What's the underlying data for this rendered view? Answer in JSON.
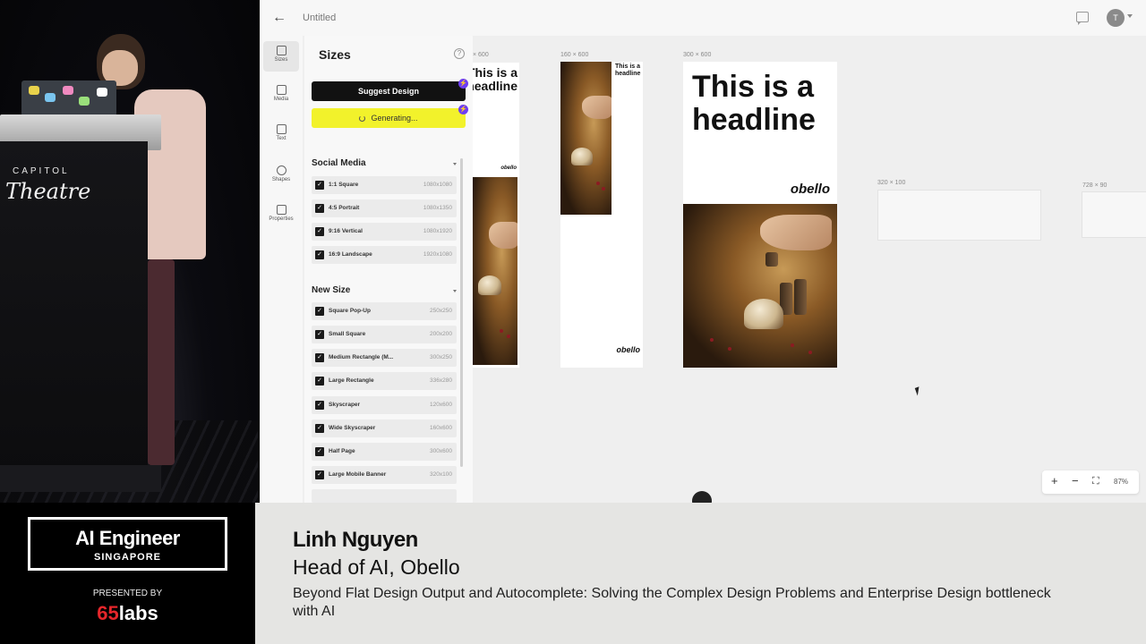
{
  "stage": {
    "venue_top": "CAPITOL",
    "venue_name": "Theatre"
  },
  "app": {
    "document_title": "Untitled",
    "user_initial": "T",
    "icons": {
      "back": "arrow-left-icon",
      "comment": "comment-icon",
      "help": "question-circle-icon",
      "lightning": "lightning-icon"
    },
    "rail": [
      {
        "label": "Sizes",
        "icon": "sizes-icon",
        "active": true
      },
      {
        "label": "Media",
        "icon": "media-icon",
        "active": false
      },
      {
        "label": "Text",
        "icon": "text-icon",
        "active": false
      },
      {
        "label": "Shapes",
        "icon": "shapes-icon",
        "active": false
      },
      {
        "label": "Properties",
        "icon": "properties-icon",
        "active": false
      }
    ],
    "panel": {
      "title": "Sizes",
      "suggest_button": "Suggest Design",
      "generating_button": "Generating...",
      "social_media": {
        "title": "Social Media",
        "items": [
          {
            "name": "1:1 Square",
            "dims": "1080x1080"
          },
          {
            "name": "4:5 Portrait",
            "dims": "1080x1350"
          },
          {
            "name": "9:16 Vertical",
            "dims": "1080x1920"
          },
          {
            "name": "16:9 Landscape",
            "dims": "1920x1080"
          }
        ]
      },
      "new_size": {
        "title": "New Size",
        "items": [
          {
            "name": "Square Pop-Up",
            "dims": "250x250"
          },
          {
            "name": "Small Square",
            "dims": "200x200"
          },
          {
            "name": "Medium Rectangle (M...",
            "dims": "300x250"
          },
          {
            "name": "Large Rectangle",
            "dims": "336x280"
          },
          {
            "name": "Skyscraper",
            "dims": "120x600"
          },
          {
            "name": "Wide Skyscraper",
            "dims": "160x600"
          },
          {
            "name": "Half Page",
            "dims": "300x600"
          },
          {
            "name": "Large Mobile Banner",
            "dims": "320x100"
          }
        ]
      }
    },
    "canvas": {
      "artboards": [
        {
          "label": "× 600",
          "headline": "This is a headline",
          "logo": "obello"
        },
        {
          "label": "160 × 600",
          "headline": "This is a headline",
          "logo": "obello"
        },
        {
          "label": "300 × 600",
          "headline": "This is a headline",
          "logo": "obello"
        },
        {
          "label": "320 × 100"
        },
        {
          "label": "728 × 90"
        }
      ],
      "zoom": "87%"
    },
    "colors": {
      "generate_yellow": "#f2f22b",
      "accent_purple": "#6d3df2",
      "dark_button": "#111111"
    }
  },
  "lower_third": {
    "event_name": "AI Engineer",
    "event_location": "SINGAPORE",
    "presented_by": "PRESENTED BY",
    "sponsor_number": "65",
    "sponsor_name": "labs",
    "speaker_name": "Linh Nguyen",
    "speaker_role": "Head of AI, Obello",
    "talk_title": "Beyond Flat Design Output and Autocomplete: Solving the Complex Design Problems and Enterprise Design bottleneck with AI"
  }
}
